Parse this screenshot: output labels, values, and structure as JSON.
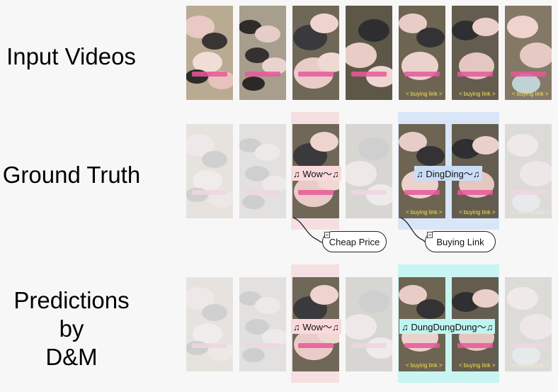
{
  "rows": {
    "input": "Input Videos",
    "truth": "Ground Truth",
    "pred": [
      "Predictions",
      "by",
      "D&M"
    ]
  },
  "captions": {
    "truth_a": "♫ Wow～♫",
    "truth_b": "♫ DingDing～♫",
    "pred_a": "♫ Wow～♫",
    "pred_b": "♫ DungDungDung～♫"
  },
  "bubbles": {
    "cheap": "Cheap Price",
    "buying": "Buying Link"
  },
  "overlay_text": {
    "buying_link": "< buying link >"
  },
  "colors": {
    "pink_highlight": "#f6dfe2",
    "blue_highlight": "#d8e6f7",
    "cyan_highlight": "#c8f5f2",
    "caption_pink": "#f9d9dc",
    "caption_blue": "#c9def6",
    "caption_cyan": "#bff4f0"
  }
}
